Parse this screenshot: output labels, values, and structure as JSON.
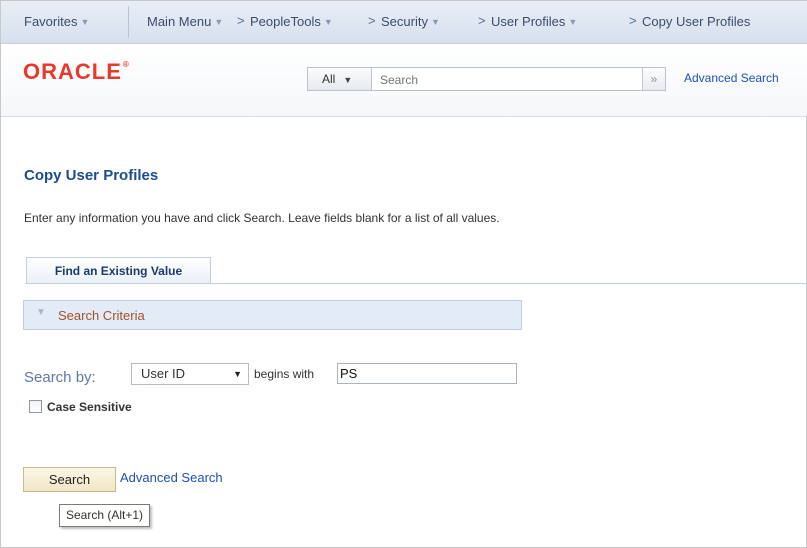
{
  "nav": {
    "favorites": "Favorites",
    "main_menu": "Main Menu",
    "breadcrumbs": [
      "PeopleTools",
      "Security",
      "User Profiles",
      "Copy User Profiles"
    ],
    "separator": ">"
  },
  "header": {
    "logo": "ORACLE",
    "search_scope": "All",
    "search_placeholder": "Search",
    "advanced_search": "Advanced Search"
  },
  "page": {
    "title": "Copy User Profiles",
    "instructions": "Enter any information you have and click Search. Leave fields blank for a list of all values.",
    "tab_label": "Find an Existing Value",
    "criteria_label": "Search Criteria",
    "search_by_label": "Search by:",
    "search_by_value": "User ID",
    "operator_label": "begins with",
    "search_value": "PS",
    "case_sensitive_label": "Case Sensitive",
    "search_button": "Search",
    "advanced_search_link": "Advanced Search",
    "tooltip": "Search (Alt+1)"
  },
  "colors": {
    "logo_red": "#e8392a",
    "title_blue": "#1e4c91",
    "link_blue": "#1f4fb8",
    "criteria_bg": "#e3ebf7"
  }
}
